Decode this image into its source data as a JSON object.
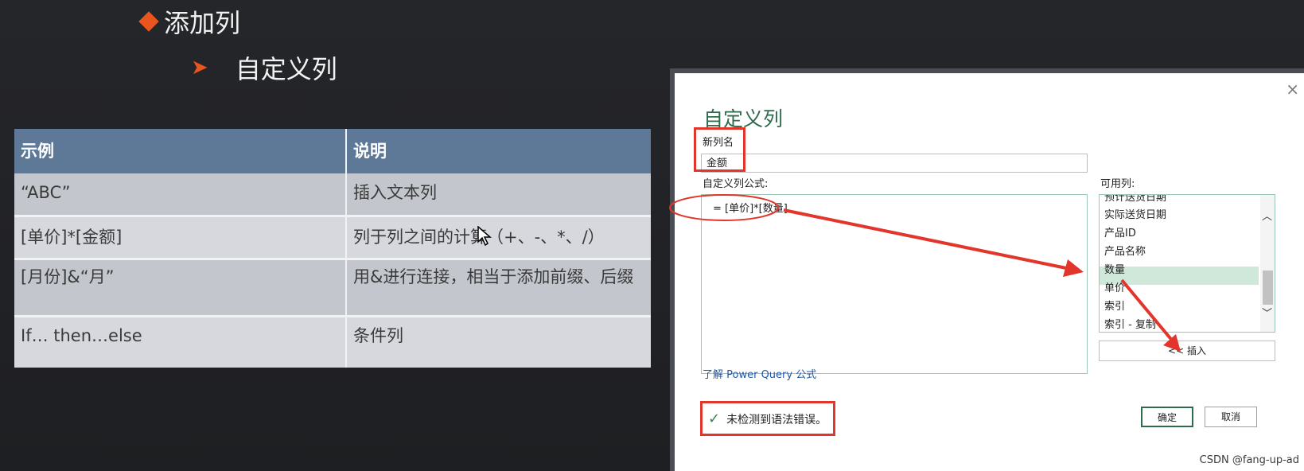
{
  "slide": {
    "heading": "添加列",
    "subheading": "自定义列"
  },
  "table": {
    "headers": [
      "示例",
      "说明"
    ],
    "rows": [
      {
        "example": "“ABC”",
        "description": "插入文本列"
      },
      {
        "example": "[单价]*[金额]",
        "description": "列于列之间的计算（+、-、*、/）"
      },
      {
        "example": "[月份]&“月”",
        "description": "用&进行连接，相当于添加前缀、后缀"
      },
      {
        "example": "If… then…else",
        "description": "条件列"
      }
    ]
  },
  "dialog": {
    "title": "自定义列",
    "close_icon": "×",
    "new_column_label": "新列名",
    "new_column_value": "金额",
    "formula_label": "自定义列公式:",
    "formula_value": "= [单价]*[数量]",
    "available_columns_label": "可用列:",
    "available_columns": [
      "预计送货日期",
      "实际送货日期",
      "产品ID",
      "产品名称",
      "数量",
      "单价",
      "索引",
      "索引 - 复制"
    ],
    "selected_column": "数量",
    "insert_button": "<< 插入",
    "learn_link": "了解 Power Query 公式",
    "status_text": "未检测到语法错误。",
    "ok_button": "确定",
    "cancel_button": "取消"
  },
  "watermark": "CSDN @fang-up-ad",
  "colors": {
    "accent": "#e8551d",
    "table_header": "#5e7898",
    "annotation_red": "#e2352b",
    "dialog_title": "#2e6b4d"
  }
}
